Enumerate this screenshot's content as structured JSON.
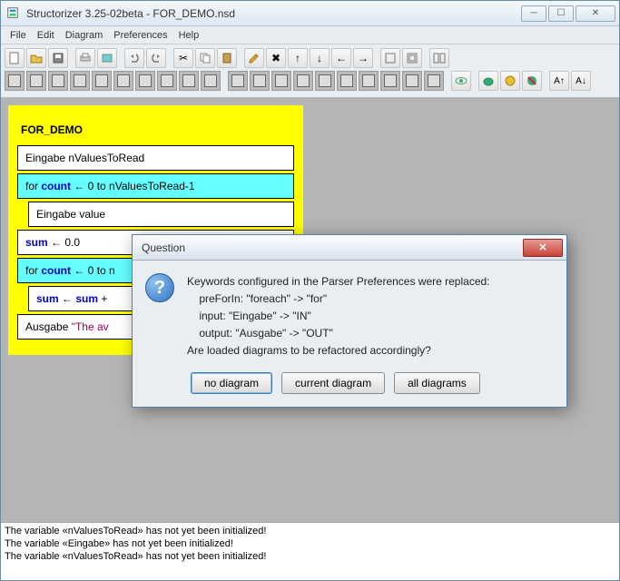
{
  "window": {
    "title": "Structorizer 3.25-02beta - FOR_DEMO.nsd"
  },
  "menu": {
    "file": "File",
    "edit": "Edit",
    "diagram": "Diagram",
    "preferences": "Preferences",
    "help": "Help"
  },
  "diagram": {
    "title": "FOR_DEMO",
    "input1": "Eingabe nValuesToRead",
    "for1_pre": "for ",
    "for1_kw": "count",
    "for1_post": " ← 0 to nValuesToRead-1",
    "inner1": "Eingabe value",
    "assign1_kw": "sum",
    "assign1_post": " ← 0.0",
    "for2_pre": "for ",
    "for2_kw": "count",
    "for2_post": " ← 0 to n",
    "inner2_kw": "sum",
    "inner2_mid": " ← ",
    "inner2_kw2": "sum",
    "inner2_post": " +",
    "output_pre": "Ausgabe ",
    "output_str": "\"The av"
  },
  "dialog": {
    "title": "Question",
    "line1": "Keywords configured in the Parser Preferences were replaced:",
    "line2": "    preForIn: \"foreach\" -> \"for\"",
    "line3": "    input: \"Eingabe\" -> \"IN\"",
    "line4": "    output: \"Ausgabe\" -> \"OUT\"",
    "line5": "Are loaded diagrams to be refactored accordingly?",
    "btn_no": "no diagram",
    "btn_current": "current diagram",
    "btn_all": "all diagrams"
  },
  "status": {
    "msg1": "The variable «nValuesToRead» has not yet been initialized!",
    "msg2": "The variable «Eingabe» has not yet been initialized!",
    "msg3": "The variable «nValuesToRead» has not yet been initialized!"
  }
}
